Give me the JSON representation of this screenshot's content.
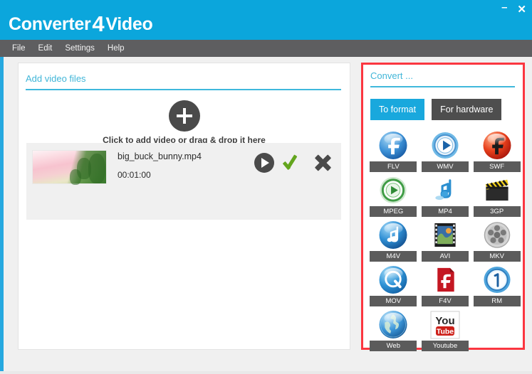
{
  "window": {
    "title_part1": "Converter",
    "title_big": "4",
    "title_part2": "Video",
    "minimize_label": "–",
    "close_label": "✕"
  },
  "menubar": {
    "items": [
      {
        "label": "File"
      },
      {
        "label": "Edit"
      },
      {
        "label": "Settings"
      },
      {
        "label": "Help"
      }
    ]
  },
  "left_panel": {
    "section_title": "Add video files",
    "dropzone_text": "Click to add video or drag & drop it here",
    "add_icon": "plus-icon",
    "files": [
      {
        "name": "big_buck_bunny.mp4",
        "duration": "00:01:00",
        "thumbnail": "video-thumbnail",
        "actions": [
          {
            "name": "play-button",
            "icon": "play-icon"
          },
          {
            "name": "convert-confirm-button",
            "icon": "check-icon"
          },
          {
            "name": "remove-file-button",
            "icon": "close-icon"
          }
        ]
      }
    ]
  },
  "right_panel": {
    "section_title": "Convert ...",
    "tabs": [
      {
        "label": "To format",
        "active": true
      },
      {
        "label": "For hardware",
        "active": false
      }
    ],
    "formats": [
      {
        "label": "FLV",
        "icon": "flv-icon"
      },
      {
        "label": "WMV",
        "icon": "wmv-icon"
      },
      {
        "label": "SWF",
        "icon": "swf-icon"
      },
      {
        "label": "MPEG",
        "icon": "mpeg-icon"
      },
      {
        "label": "MP4",
        "icon": "mp4-icon"
      },
      {
        "label": "3GP",
        "icon": "3gp-icon"
      },
      {
        "label": "M4V",
        "icon": "m4v-icon"
      },
      {
        "label": "AVI",
        "icon": "avi-icon"
      },
      {
        "label": "MKV",
        "icon": "mkv-icon"
      },
      {
        "label": "MOV",
        "icon": "mov-icon"
      },
      {
        "label": "F4V",
        "icon": "f4v-icon"
      },
      {
        "label": "RM",
        "icon": "rm-icon"
      },
      {
        "label": "Web",
        "icon": "web-icon"
      },
      {
        "label": "Youtube",
        "icon": "youtube-icon"
      }
    ]
  },
  "colors": {
    "titlebar": "#0ba6dc",
    "menubar": "#5e5e60",
    "accent": "#3fb8dc",
    "highlight_border": "#fb3640",
    "active_tab": "#19a8dd",
    "inactive_tab": "#4e4e4e",
    "label_chip": "#5b5b5b",
    "check_green": "#63a51e"
  }
}
